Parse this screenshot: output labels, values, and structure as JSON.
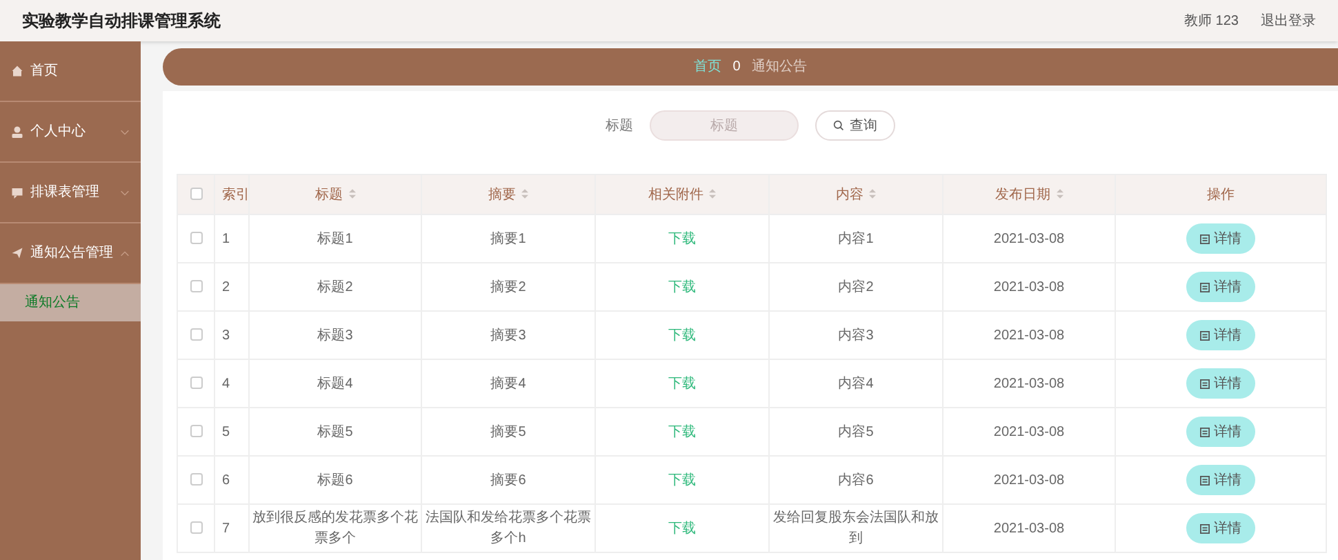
{
  "header": {
    "title": "实验教学自动排课管理系统",
    "user": "教师 123",
    "logout": "退出登录"
  },
  "sidebar": {
    "items": [
      {
        "label": "首页",
        "kind": "link"
      },
      {
        "label": "个人中心",
        "kind": "menu",
        "expanded": false
      },
      {
        "label": "排课表管理",
        "kind": "menu",
        "expanded": false
      },
      {
        "label": "通知公告管理",
        "kind": "menu",
        "expanded": true,
        "children": [
          {
            "label": "通知公告",
            "selected": true
          }
        ]
      }
    ]
  },
  "breadcrumb": {
    "home": "首页",
    "separator": "0",
    "current": "通知公告"
  },
  "search": {
    "label": "标题",
    "placeholder": "标题",
    "button": "查询"
  },
  "table": {
    "all_checked": false,
    "columns": [
      {
        "label": "索引",
        "sortable": false
      },
      {
        "label": "标题",
        "sortable": true
      },
      {
        "label": "摘要",
        "sortable": true
      },
      {
        "label": "相关附件",
        "sortable": true
      },
      {
        "label": "内容",
        "sortable": true
      },
      {
        "label": "发布日期",
        "sortable": true
      },
      {
        "label": "操作",
        "sortable": false
      }
    ],
    "rows": [
      {
        "checked": false,
        "index": "1",
        "title": "标题1",
        "summary": "摘要1",
        "attachment": "下载",
        "content": "内容1",
        "date": "2021-03-08",
        "action": "详情"
      },
      {
        "checked": false,
        "index": "2",
        "title": "标题2",
        "summary": "摘要2",
        "attachment": "下载",
        "content": "内容2",
        "date": "2021-03-08",
        "action": "详情"
      },
      {
        "checked": false,
        "index": "3",
        "title": "标题3",
        "summary": "摘要3",
        "attachment": "下载",
        "content": "内容3",
        "date": "2021-03-08",
        "action": "详情"
      },
      {
        "checked": false,
        "index": "4",
        "title": "标题4",
        "summary": "摘要4",
        "attachment": "下载",
        "content": "内容4",
        "date": "2021-03-08",
        "action": "详情"
      },
      {
        "checked": false,
        "index": "5",
        "title": "标题5",
        "summary": "摘要5",
        "attachment": "下载",
        "content": "内容5",
        "date": "2021-03-08",
        "action": "详情"
      },
      {
        "checked": false,
        "index": "6",
        "title": "标题6",
        "summary": "摘要6",
        "attachment": "下载",
        "content": "内容6",
        "date": "2021-03-08",
        "action": "详情"
      },
      {
        "checked": false,
        "index": "7",
        "title": "放到很反感的发花票多个花票多个",
        "summary": "法国队和发给花票多个花票多个h",
        "attachment": "下载",
        "content": "发给回复股东会法国队和放到",
        "date": "2021-03-08",
        "action": "详情"
      }
    ]
  }
}
